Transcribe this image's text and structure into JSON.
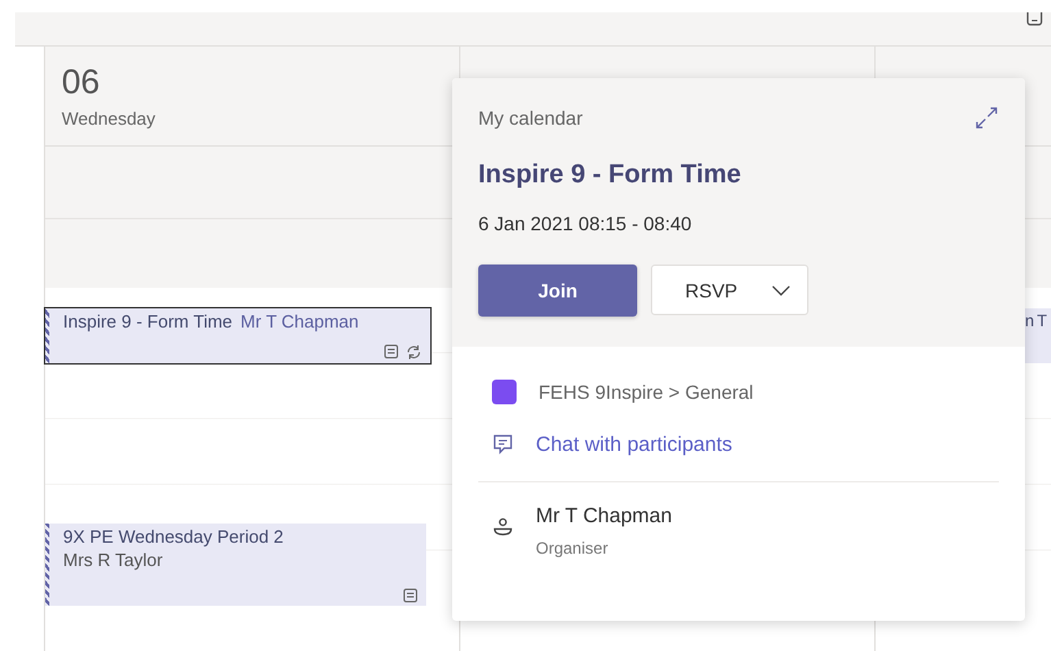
{
  "day_columns": [
    {
      "number": "06",
      "weekday": "Wednesday",
      "events": [
        {
          "kind": "short",
          "title": "Inspire 9 - Form Time",
          "organiser": "Mr T Chapman",
          "selected": true,
          "notes": true,
          "recurring": true
        },
        {
          "kind": "tall",
          "title": "9X PE Wednesday Period 2",
          "organiser": "Mrs R Taylor",
          "selected": false,
          "notes": true,
          "recurring": false
        }
      ]
    },
    {},
    {
      "events": [
        {
          "kind": "covered",
          "title": "n T",
          "selected": false
        }
      ]
    }
  ],
  "popup": {
    "calendar": "My calendar",
    "title": "Inspire 9 - Form Time",
    "when": "6 Jan 2021 08:15 - 08:40",
    "join": "Join",
    "rsvp": "RSVP",
    "channel": "FEHS 9Inspire > General",
    "chat": "Chat with participants",
    "organiser": {
      "name": "Mr T Chapman",
      "role": "Organiser"
    }
  }
}
